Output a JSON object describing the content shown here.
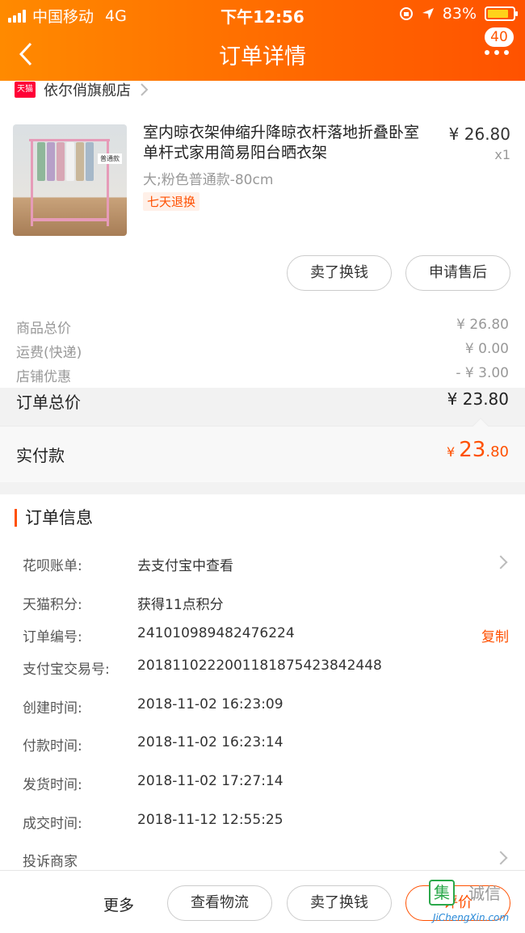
{
  "status_bar": {
    "carrier": "中国移动",
    "network": "4G",
    "time": "下午12:56",
    "battery": "83%",
    "battery_level": 0.83
  },
  "nav": {
    "title": "订单详情",
    "badge": "40"
  },
  "shop": {
    "logo_text": "天猫",
    "name": "依尔俏旗舰店"
  },
  "product": {
    "title": "室内晾衣架伸缩升降晾衣杆落地折叠卧室单杆式家用简易阳台晒衣架",
    "spec": "大;粉色普通款-80cm",
    "tag": "七天退换",
    "price": "¥ 26.80",
    "qty": "x1",
    "thumb_label": "普通款"
  },
  "actions": {
    "sell": "卖了换钱",
    "after_sale": "申请售后"
  },
  "summary": [
    {
      "label": "商品总价",
      "value": "¥ 26.80"
    },
    {
      "label": "运费(快递)",
      "value": "¥ 0.00"
    },
    {
      "label": "店铺优惠",
      "value": "- ¥ 3.00"
    }
  ],
  "total": {
    "label": "订单总价",
    "value": "¥ 23.80"
  },
  "paid": {
    "label": "实付款",
    "yen": "¥ ",
    "integer": "23",
    "decimal": ".80"
  },
  "order_info": {
    "title": "订单信息",
    "rows": [
      {
        "key": "花呗账单:",
        "value": "去支付宝中查看",
        "chevron": true
      },
      {
        "key": "天猫积分:",
        "value": "获得11点积分"
      },
      {
        "key": "订单编号:",
        "value": "241010989482476224",
        "action": "复制"
      },
      {
        "key": "支付宝交易号:",
        "value": "2018110222001181875423842448"
      },
      {
        "key": "创建时间:",
        "value": "2018-11-02 16:23:09"
      },
      {
        "key": "付款时间:",
        "value": "2018-11-02 16:23:14"
      },
      {
        "key": "发货时间:",
        "value": "2018-11-02 17:27:14"
      },
      {
        "key": "成交时间:",
        "value": "2018-11-12 12:55:25"
      }
    ],
    "complain": "投诉商家"
  },
  "bottom_bar": {
    "more": "更多",
    "logistics": "查看物流",
    "sell": "卖了换钱",
    "third": "评价"
  },
  "watermark": {
    "text": "JiChengXin.com"
  },
  "colors": {
    "accent": "#ff5000",
    "header_start": "#ff8a00",
    "header_end": "#ff5200"
  }
}
